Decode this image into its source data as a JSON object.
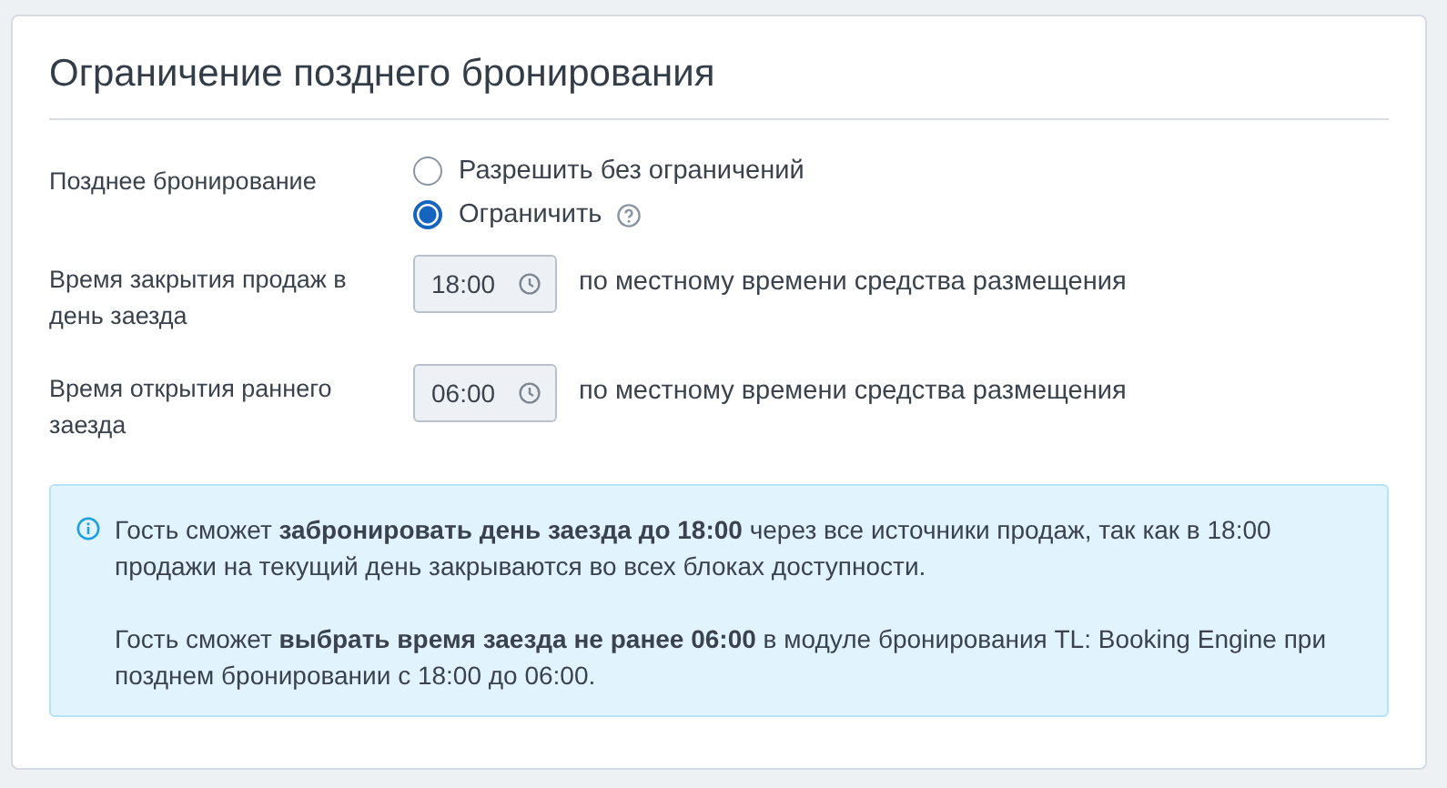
{
  "title": "Ограничение позднего бронирования",
  "late_booking": {
    "label": "Позднее бронирование",
    "options": [
      {
        "label": "Разрешить без ограничений",
        "selected": false,
        "help": false
      },
      {
        "label": "Ограничить",
        "selected": true,
        "help": true
      }
    ]
  },
  "time_rows": [
    {
      "label": "Время закрытия продаж в день заезда",
      "value": "18:00",
      "note": "по местному времени средства размещения"
    },
    {
      "label": "Время открытия раннего заезда",
      "value": "06:00",
      "note": "по местному времени средства размещения"
    }
  ],
  "info": [
    "Гость сможет **забронировать день заезда до 18:00** через все источники продаж, так как в 18:00 продажи на текущий день закрываются во всех блоках доступности.",
    "Гость сможет **выбрать время заезда не ранее 06:00** в модуле бронирования TL: Booking Engine при позднем бронировании с 18:00 до 06:00."
  ]
}
